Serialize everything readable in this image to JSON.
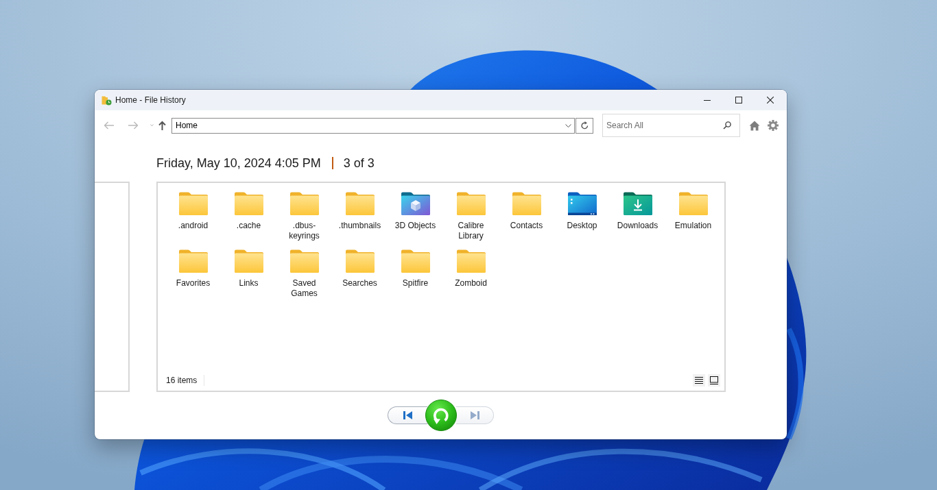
{
  "window": {
    "title": "Home - File History"
  },
  "toolbar": {
    "nav_buttons": [
      {
        "kind": "back",
        "disabled": true
      },
      {
        "kind": "forward",
        "disabled": true
      },
      {
        "kind": "recent",
        "disabled": true
      },
      {
        "kind": "up",
        "disabled": false
      }
    ],
    "address": {
      "value": "Home"
    },
    "search": {
      "placeholder": "Search All"
    }
  },
  "version_header": {
    "date": "Friday, May 10, 2024 4:05 PM",
    "position": "3 of 3"
  },
  "folders": [
    {
      "name": ".android",
      "kind": "folder"
    },
    {
      "name": ".cache",
      "kind": "folder"
    },
    {
      "name": ".dbus-keyrings",
      "kind": "folder"
    },
    {
      "name": ".thumbnails",
      "kind": "folder"
    },
    {
      "name": "3D Objects",
      "kind": "objects"
    },
    {
      "name": "Calibre Library",
      "kind": "folder"
    },
    {
      "name": "Contacts",
      "kind": "folder"
    },
    {
      "name": "Desktop",
      "kind": "desktop"
    },
    {
      "name": "Downloads",
      "kind": "downloads"
    },
    {
      "name": "Emulation",
      "kind": "folder"
    },
    {
      "name": "Favorites",
      "kind": "folder"
    },
    {
      "name": "Links",
      "kind": "folder"
    },
    {
      "name": "Saved Games",
      "kind": "folder"
    },
    {
      "name": "Searches",
      "kind": "folder"
    },
    {
      "name": "Spitfire",
      "kind": "folder"
    },
    {
      "name": "Zomboid",
      "kind": "folder"
    }
  ],
  "status_bar": {
    "item_count": "16 items"
  },
  "playback": [
    {
      "kind": "previous",
      "disabled": false
    },
    {
      "kind": "restore",
      "disabled": false
    },
    {
      "kind": "next",
      "disabled": true
    }
  ]
}
